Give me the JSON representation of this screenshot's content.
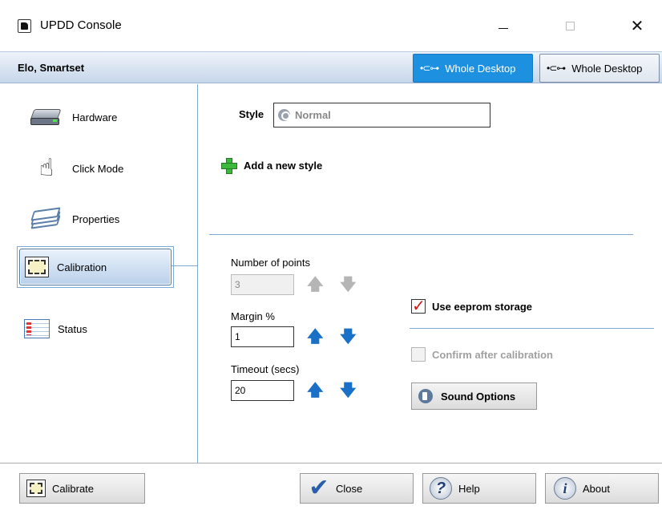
{
  "window": {
    "title": "UPDD Console",
    "close_glyph": "✕"
  },
  "device_bar": {
    "device_name": "Elo, Smartset",
    "desktop_buttons": [
      {
        "label": "Whole Desktop",
        "active": true,
        "icon": "usb-icon"
      },
      {
        "label": "Whole Desktop",
        "active": false,
        "icon": "usb-icon"
      }
    ]
  },
  "sidebar": {
    "items": [
      {
        "label": "Hardware",
        "icon": "hardware-icon"
      },
      {
        "label": "Click Mode",
        "icon": "hand-pointer-icon"
      },
      {
        "label": "Properties",
        "icon": "layers-icon"
      },
      {
        "label": "Calibration",
        "icon": "calibration-icon",
        "selected": true
      },
      {
        "label": "Status",
        "icon": "status-icon"
      }
    ]
  },
  "calibration": {
    "style_label": "Style",
    "style_value": "Normal",
    "add_style_label": "Add a new style",
    "points_label": "Number of points",
    "points_value": "3",
    "margin_label": "Margin %",
    "margin_value": "1",
    "timeout_label": "Timeout (secs)",
    "timeout_value": "20",
    "use_eeprom_label": "Use eeprom storage",
    "use_eeprom_checked": true,
    "confirm_label": "Confirm after calibration",
    "confirm_checked": false,
    "sound_options_label": "Sound Options",
    "arrow_up_glyph": "🡅",
    "arrow_down_glyph": "🡇",
    "checkmark_glyph": "✓"
  },
  "footer": {
    "calibrate_label": "Calibrate",
    "close_label": "Close",
    "help_label": "Help",
    "about_label": "About",
    "help_glyph": "?",
    "about_glyph": "i",
    "close_glyph": "✔"
  },
  "colors": {
    "accent": "#1e90e0",
    "separator": "#7da9d6",
    "arrow_active": "#1a6fc7",
    "checkmark": "#d01818",
    "plus_green": "#3cb93c"
  }
}
